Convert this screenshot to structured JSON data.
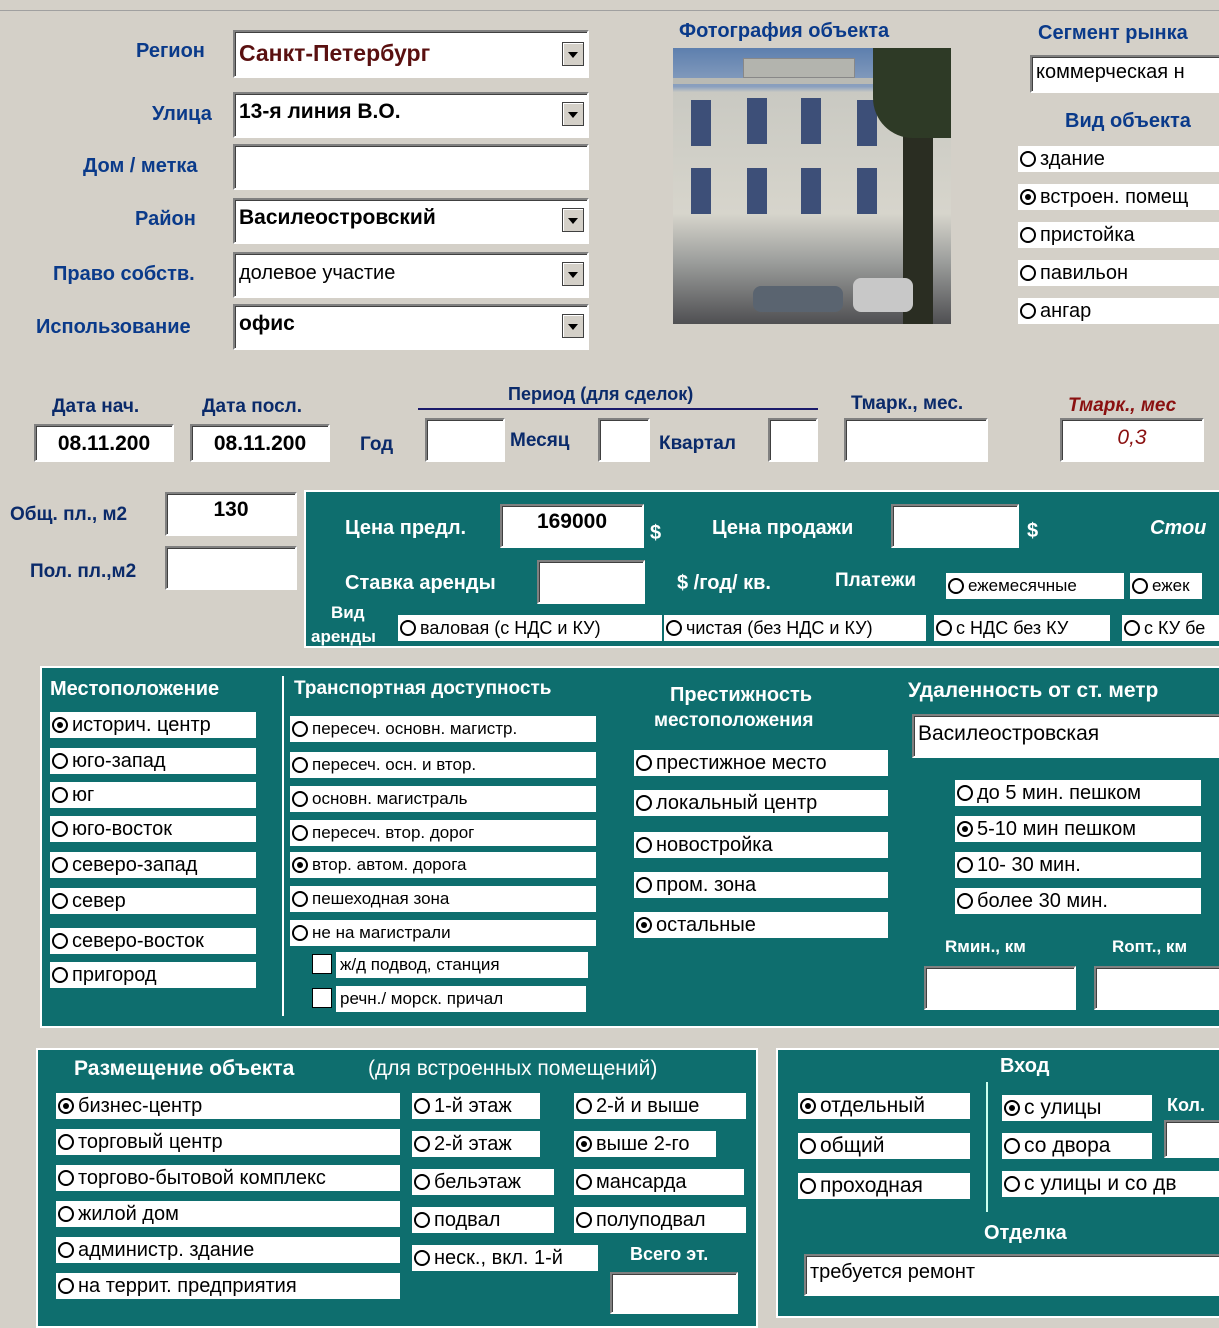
{
  "top": {
    "region": {
      "label": "Регион",
      "value": "Санкт-Петербург"
    },
    "street": {
      "label": "Улица",
      "value": "13-я линия В.О."
    },
    "house": {
      "label": "Дом / метка",
      "value": ""
    },
    "district": {
      "label": "Район",
      "value": "Василеостровский"
    },
    "ownership": {
      "label": "Право собств.",
      "value": "долевое участие"
    },
    "usage": {
      "label": "Использование",
      "value": "офис"
    },
    "photo_label": "Фотография объекта",
    "segment": {
      "label": "Сегмент рынка",
      "value": "коммерческая н"
    },
    "object_type": {
      "label": "Вид объекта",
      "options": [
        "здание",
        "встроен. помещ",
        "пристойка",
        "павильон",
        "ангар"
      ],
      "selected": 1
    }
  },
  "dates": {
    "start_label": "Дата нач.",
    "start_value": "08.11.200",
    "last_label": "Дата посл.",
    "last_value": "08.11.200",
    "period_label": "Период (для сделок)",
    "year_label": "Год",
    "year_value": "",
    "month_label": "Месяц",
    "month_value": "",
    "quarter_label": "Квартал",
    "quarter_value": "",
    "tmark_label": "Тмарк., мес.",
    "tmark_value": "",
    "tmark2_label": "Тмарк., мес",
    "tmark2_value": "0,3"
  },
  "area": {
    "total_label": "Общ. пл., м2",
    "total_value": "130",
    "useful_label": "Пол. пл.,м2",
    "useful_value": ""
  },
  "price": {
    "offer_label": "Цена предл.",
    "offer_value": "169000",
    "currency": "$",
    "sale_label": "Цена продажи",
    "sale_value": "",
    "cost_label": "Стои",
    "rent_label": "Ставка аренды",
    "rent_value": "",
    "rent_unit": "$ /год/ кв.",
    "payments_label": "Платежи",
    "payments_options": [
      "ежемесячные",
      "ежек"
    ],
    "lease_label_1": "Вид",
    "lease_label_2": "аренды",
    "lease_options": [
      "валовая (с НДС и КУ)",
      "чистая (без НДС и КУ)",
      "с НДС без КУ",
      "с КУ бе"
    ]
  },
  "location": {
    "title": "Местоположение",
    "options": [
      "историч. центр",
      "юго-запад",
      "юг",
      "юго-восток",
      "северо-запад",
      "север",
      "северо-восток",
      "пригород"
    ],
    "selected": 0
  },
  "transport": {
    "title": "Транспортная доступность",
    "options": [
      "пересеч. основн. магистр.",
      "пересеч. осн. и втор.",
      "основн. магистраль",
      "пересеч. втор. дорог",
      "втор. автом. дорога",
      "пешеходная зона",
      "не на магистрали"
    ],
    "selected": 4,
    "checks": [
      "ж/д подвод, станция",
      "речн./ морск. причал"
    ]
  },
  "prestige": {
    "title_1": "Престижность",
    "title_2": "местоположения",
    "options": [
      "престижное место",
      "локальный центр",
      "новостройка",
      "пром. зона",
      "остальные"
    ],
    "selected": 4
  },
  "metro": {
    "title": "Удаленность от ст. метр",
    "station": "Василеостровская",
    "options": [
      "до 5 мин. пешком",
      "5-10 мин пешком",
      "10- 30 мин.",
      "более 30 мин."
    ],
    "selected": 1,
    "rmin_label": "Rмин., км",
    "rmin_value": "",
    "ropt_label": "Rопт., км",
    "ropt_value": ""
  },
  "placement": {
    "title": "Размещение объекта",
    "subtitle": "(для встроенных помещений)",
    "options": [
      "бизнес-центр",
      "торговый центр",
      "торгово-бытовой комплекс",
      "жилой дом",
      "администр. здание",
      "на террит. предприятия"
    ],
    "selected": 0,
    "floor_col1": [
      "1-й этаж",
      "2-й этаж",
      "бельэтаж",
      "подвал",
      "неск., вкл. 1-й"
    ],
    "floor_col2": [
      "2-й и выше",
      "выше 2-го",
      "мансарда",
      "полуподвал"
    ],
    "floor_selected": "выше 2-го",
    "total_floors_label": "Всего эт.",
    "total_floors_value": ""
  },
  "entrance": {
    "title": "Вход",
    "type_options": [
      "отдельный",
      "общий",
      "проходная"
    ],
    "type_selected": 0,
    "from_options": [
      "с улицы",
      "со двора",
      "с улицы и со дв"
    ],
    "from_selected": 0,
    "count_label": "Кол.",
    "count_value": "",
    "finish_label": "Отделка",
    "finish_value": "требуется ремонт"
  }
}
